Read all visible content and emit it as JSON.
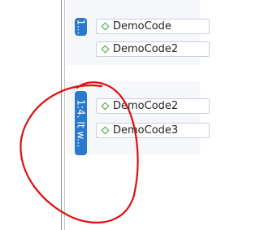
{
  "lanes": [
    {
      "badge": "1...",
      "items": [
        "DemoCode",
        "DemoCode2"
      ]
    },
    {
      "badge": "1:4. It w...",
      "items": [
        "DemoCode2",
        "DemoCode3"
      ]
    }
  ],
  "colors": {
    "badge": "#2b79cc",
    "annotation": "#e10d0d",
    "item_icon": "#3ea43a"
  },
  "icons": {
    "item": "diamond-outline-icon"
  }
}
